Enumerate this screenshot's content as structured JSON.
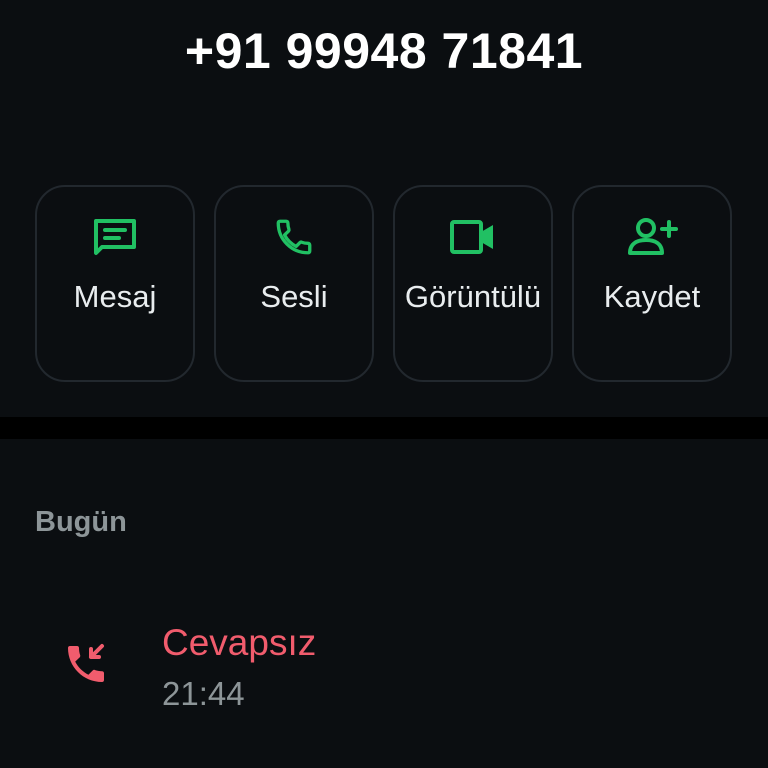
{
  "contact": {
    "phone_number": "+91 99948 71841"
  },
  "actions": [
    {
      "label": "Mesaj",
      "icon": "message-icon"
    },
    {
      "label": "Sesli",
      "icon": "phone-icon"
    },
    {
      "label": "Görüntülü",
      "icon": "video-icon"
    },
    {
      "label": "Kaydet",
      "icon": "add-contact-icon"
    }
  ],
  "history": {
    "section_title": "Bugün",
    "calls": [
      {
        "status": "Cevapsız",
        "time": "21:44",
        "icon": "missed-call-icon"
      }
    ]
  },
  "colors": {
    "background": "#0b0e11",
    "accent_green": "#21c063",
    "missed_red": "#f15c6d",
    "muted_text": "#8d9598"
  }
}
